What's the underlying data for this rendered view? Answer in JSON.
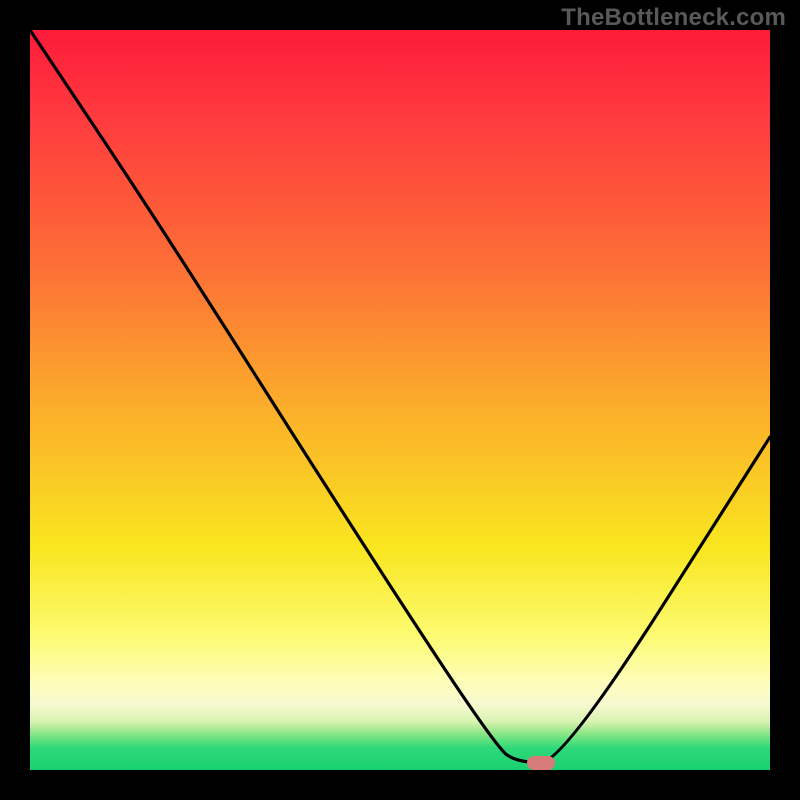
{
  "watermark": "TheBottleneck.com",
  "colors": {
    "frame_bg": "#000000",
    "gradient_top": "#fd1b3a",
    "gradient_mid1": "#fbb12a",
    "gradient_mid2": "#f9e61f",
    "gradient_bottom": "#18d070",
    "curve_stroke": "#000000",
    "marker_fill": "#d77a7a",
    "watermark_color": "#595959"
  },
  "chart_data": {
    "type": "line",
    "title": "",
    "xlabel": "",
    "ylabel": "",
    "xlim": [
      0,
      100
    ],
    "ylim": [
      0,
      100
    ],
    "grid": false,
    "legend": false,
    "annotations": [
      {
        "kind": "marker",
        "x": 69,
        "y_pct_from_top": 99,
        "note": "minimum indicator (pink pill)"
      }
    ],
    "series": [
      {
        "name": "bottleneck-curve",
        "note": "y expressed as percent-from-top of plot area (0 = top, 100 = bottom)",
        "x": [
          0,
          18,
          44,
          63,
          66,
          72,
          100
        ],
        "y_pct_from_top": [
          0,
          27,
          68,
          97,
          99,
          99,
          55
        ]
      }
    ]
  }
}
